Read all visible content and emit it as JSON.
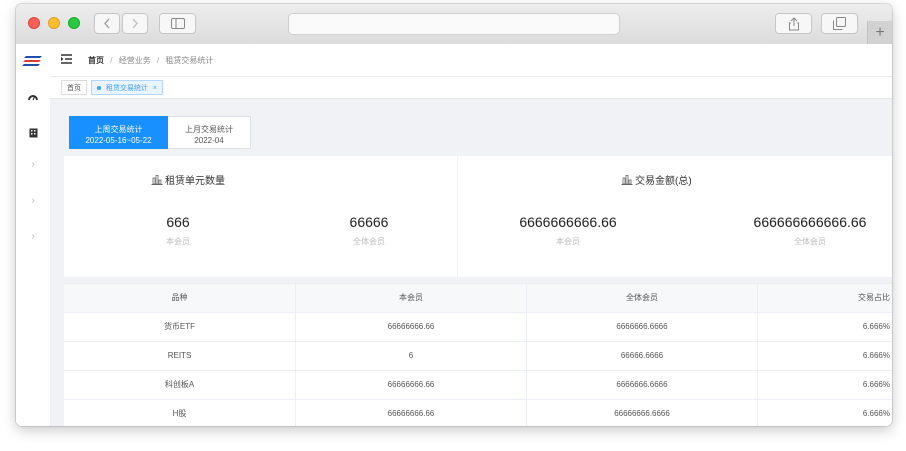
{
  "breadcrumb": [
    "首页",
    "经营业务",
    "租赁交易统计"
  ],
  "breadcrumb_sep": "/",
  "tabs": [
    {
      "label": "首页",
      "active": false
    },
    {
      "label": "租赁交易统计",
      "active": true
    }
  ],
  "tab_close": "×",
  "periods": [
    {
      "title": "上周交易统计",
      "range": "2022-05-16~05-22",
      "active": true
    },
    {
      "title": "上月交易统计",
      "range": "2022-04",
      "active": false
    }
  ],
  "cards": [
    {
      "title": "租赁单元数量",
      "stats": [
        {
          "value": "666",
          "label": "本会员"
        },
        {
          "value": "66666",
          "label": "全体会员"
        }
      ]
    },
    {
      "title": "交易金额(总)",
      "stats": [
        {
          "value": "6666666666.66",
          "label": "本会员"
        },
        {
          "value": "666666666666.66",
          "label": "全体会员"
        }
      ]
    }
  ],
  "table": {
    "headers": [
      "品种",
      "本会员",
      "全体会员",
      "交易占比"
    ],
    "rows": [
      [
        "货币ETF",
        "66666666.66",
        "6666666.6666",
        "6.666%"
      ],
      [
        "REITS",
        "6",
        "66666.6666",
        "6.666%"
      ],
      [
        "科创板A",
        "66666666.66",
        "6666666.6666",
        "6.666%"
      ],
      [
        "H股",
        "66666666.66",
        "66666666.6666",
        "6.666%"
      ]
    ]
  },
  "colors": {
    "accent": "#1890ff",
    "sidebar_logo": "#1f4fa8"
  },
  "icons": {
    "sidebar": [
      "logo-icon",
      "dashboard-icon",
      "building-icon",
      "chevron-right-icon",
      "chevron-right-icon",
      "chevron-right-icon"
    ],
    "card": "bar-chart-icon"
  }
}
